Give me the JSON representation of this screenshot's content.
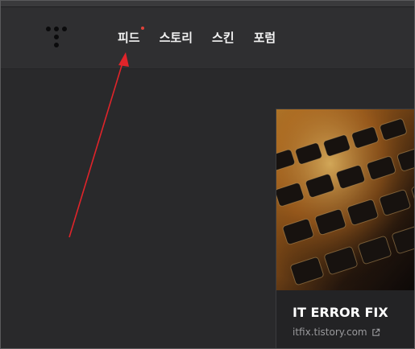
{
  "nav": {
    "items": [
      {
        "label": "피드",
        "has_new": true
      },
      {
        "label": "스토리"
      },
      {
        "label": "스킨"
      },
      {
        "label": "포럼"
      }
    ]
  },
  "card": {
    "title": "IT ERROR FIX",
    "link": "itfix.tistory.com",
    "image": "keyboard-photo"
  },
  "colors": {
    "background": "#29292b",
    "header": "#2f2f31",
    "annotation_arrow": "#e0242a",
    "new_indicator": "#e0413a"
  }
}
